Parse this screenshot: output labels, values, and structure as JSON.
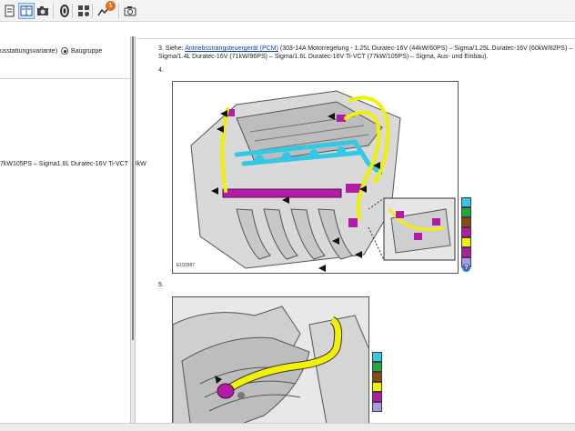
{
  "toolbar": {
    "notification_count": "1",
    "icons": [
      "document-icon",
      "pages-icon",
      "camera-icon",
      "wheel-icon",
      "components-icon",
      "route-icon",
      "camera-icon"
    ]
  },
  "left": {
    "radio_option_partial": "usstattungsvariante)",
    "radio_option_selected": "Baugruppe",
    "variant_text": "7kW105PS – Sigma1.6L Duratec-16V Ti-VCT 88kW"
  },
  "content": {
    "step3": {
      "prefix": "3. Siehe: ",
      "link": "Antriebsstrangsteuergerät (PCM)",
      "text": " (303-14A Motorregelung - 1.25L Duratec-16V (44kW/60PS) – Sigma/1.25L Duratec-16V (60kW/82PS) – Sigma/1.4L Duratec-16V (71kW/96PS) – Sigma/1.6L Duratec-16V Ti-VCT (77kW/105PS) – Sigma, Aus- und Einbau)."
    },
    "step4_label": "4.",
    "step5_label": "5.",
    "figure4_code": "E102987",
    "legend_colors": [
      "#32c8e6",
      "#21a83a",
      "#8a4a12",
      "#b31ba6",
      "#f2f200",
      "#b31ba6",
      "#a99be0"
    ],
    "legend5_colors": [
      "#32c8e6",
      "#21a83a",
      "#8a4a12",
      "#f2f200",
      "#b31ba6",
      "#a99be0"
    ],
    "help_label": "?"
  }
}
